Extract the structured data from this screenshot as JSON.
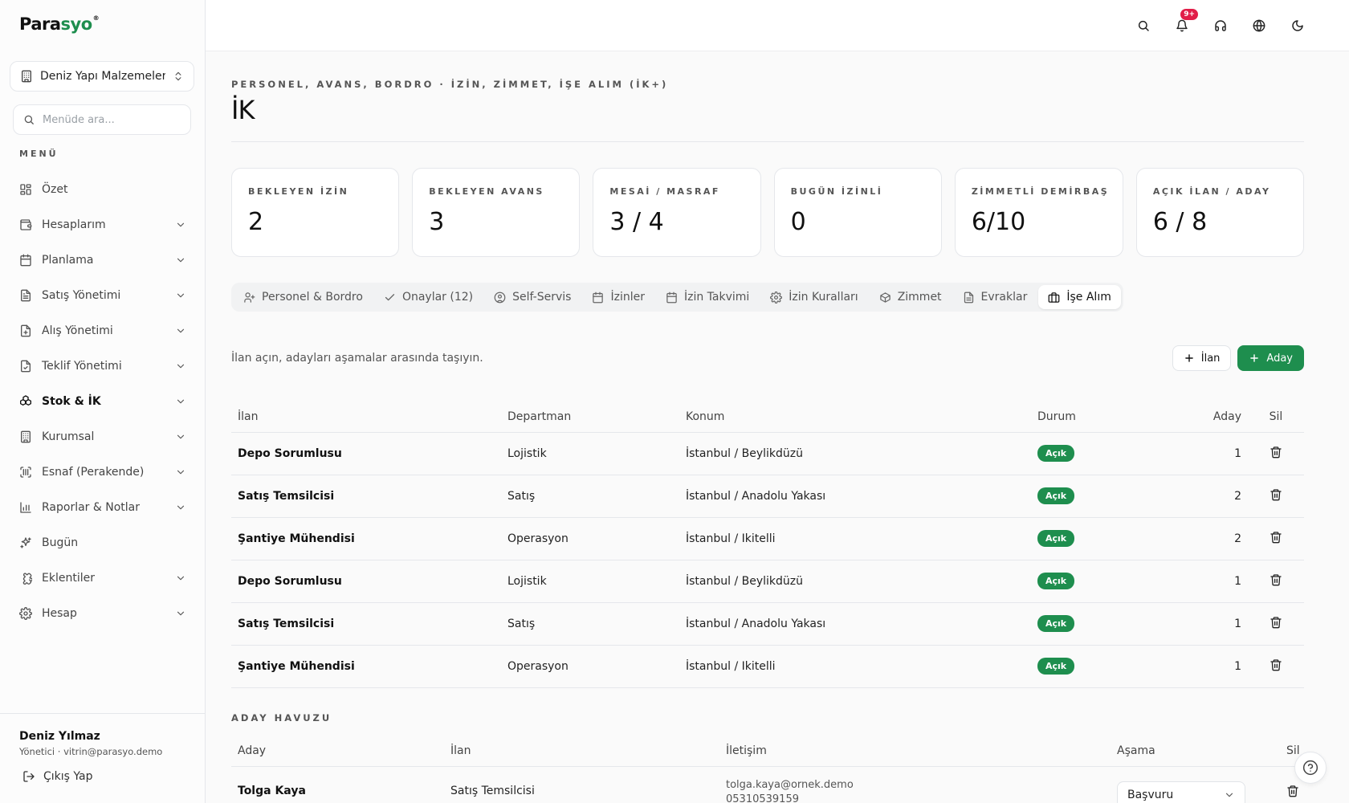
{
  "brand": {
    "prefix": "Para",
    "suffix": "syo",
    "mark": "®",
    "accent": "#1e8e4e"
  },
  "company": {
    "name": "Deniz Yapı Malzemeleri..."
  },
  "sidebar_search": {
    "placeholder": "Menüde ara..."
  },
  "menu": {
    "label": "MENÜ",
    "items": [
      {
        "label": "Özet",
        "icon": "dashboard-icon",
        "chevron": false
      },
      {
        "label": "Hesaplarım",
        "icon": "wallet-icon",
        "chevron": true
      },
      {
        "label": "Planlama",
        "icon": "calendar-icon",
        "chevron": true
      },
      {
        "label": "Satış Yönetimi",
        "icon": "receipt-icon",
        "chevron": true
      },
      {
        "label": "Alış Yönetimi",
        "icon": "file-plus-icon",
        "chevron": true
      },
      {
        "label": "Teklif Yönetimi",
        "icon": "file-check-icon",
        "chevron": true
      },
      {
        "label": "Stok & İK",
        "icon": "boxes-icon",
        "chevron": true,
        "active": true
      },
      {
        "label": "Kurumsal",
        "icon": "building-icon",
        "chevron": true
      },
      {
        "label": "Esnaf (Perakende)",
        "icon": "scan-icon",
        "chevron": true
      },
      {
        "label": "Raporlar & Notlar",
        "icon": "bar-chart-icon",
        "chevron": true
      },
      {
        "label": "Bugün",
        "icon": "sparkles-icon",
        "chevron": false
      },
      {
        "label": "Eklentiler",
        "icon": "puzzle-icon",
        "chevron": true
      },
      {
        "label": "Hesap",
        "icon": "gear-icon",
        "chevron": true
      }
    ]
  },
  "user": {
    "name": "Deniz Yılmaz",
    "role": "Yönetici · vitrin@parasyo.demo",
    "logout": "Çıkış Yap"
  },
  "topbar": {
    "notification_badge": "9+"
  },
  "page": {
    "eyebrow": "PERSONEL, AVANS, BORDRO · İZİN, ZİMMET, İŞE ALIM (İK+)",
    "title": "İK"
  },
  "stats": [
    {
      "label": "BEKLEYEN İZİN",
      "value": "2"
    },
    {
      "label": "BEKLEYEN AVANS",
      "value": "3"
    },
    {
      "label": "MESAİ / MASRAF",
      "value": "3 / 4"
    },
    {
      "label": "BUGÜN İZİNLİ",
      "value": "0"
    },
    {
      "label": "ZİMMETLİ DEMİRBAŞ",
      "value": "6/10"
    },
    {
      "label": "AÇIK İLAN / ADAY",
      "value": "6 / 8"
    }
  ],
  "tabs": [
    {
      "label": "Personel & Bordro",
      "icon": "users-icon"
    },
    {
      "label": "Onaylar (12)",
      "icon": "check-icon"
    },
    {
      "label": "Self-Servis",
      "icon": "user-circle-icon"
    },
    {
      "label": "İzinler",
      "icon": "calendar-icon"
    },
    {
      "label": "İzin Takvimi",
      "icon": "calendar-icon"
    },
    {
      "label": "İzin Kuralları",
      "icon": "gear-icon"
    },
    {
      "label": "Zimmet",
      "icon": "package-icon"
    },
    {
      "label": "Evraklar",
      "icon": "file-icon"
    },
    {
      "label": "İşe Alım",
      "icon": "briefcase-icon",
      "active": true
    }
  ],
  "recruit": {
    "description": "İlan açın, adayları aşamalar arasında taşıyın.",
    "add_posting": "İlan",
    "add_candidate": "Aday"
  },
  "jobs": {
    "columns": {
      "posting": "İlan",
      "department": "Departman",
      "location": "Konum",
      "status": "Durum",
      "candidates": "Aday",
      "delete": "Sil"
    },
    "rows": [
      {
        "posting": "Depo Sorumlusu",
        "department": "Lojistik",
        "location": "İstanbul / Beylikdüzü",
        "status": "Açık",
        "candidates": "1"
      },
      {
        "posting": "Satış Temsilcisi",
        "department": "Satış",
        "location": "İstanbul / Anadolu Yakası",
        "status": "Açık",
        "candidates": "2"
      },
      {
        "posting": "Şantiye Mühendisi",
        "department": "Operasyon",
        "location": "İstanbul / Ikitelli",
        "status": "Açık",
        "candidates": "2"
      },
      {
        "posting": "Depo Sorumlusu",
        "department": "Lojistik",
        "location": "İstanbul / Beylikdüzü",
        "status": "Açık",
        "candidates": "1"
      },
      {
        "posting": "Satış Temsilcisi",
        "department": "Satış",
        "location": "İstanbul / Anadolu Yakası",
        "status": "Açık",
        "candidates": "1"
      },
      {
        "posting": "Şantiye Mühendisi",
        "department": "Operasyon",
        "location": "İstanbul / Ikitelli",
        "status": "Açık",
        "candidates": "1"
      }
    ]
  },
  "pool": {
    "label": "ADAY HAVUZU",
    "columns": {
      "candidate": "Aday",
      "posting": "İlan",
      "contact": "İletişim",
      "stage": "Aşama",
      "delete": "Sil"
    },
    "rows": [
      {
        "candidate": "Tolga Kaya",
        "posting": "Satış Temsilcisi",
        "email": "tolga.kaya@ornek.demo",
        "phone": "05310539159",
        "stage": "Başvuru"
      }
    ]
  }
}
